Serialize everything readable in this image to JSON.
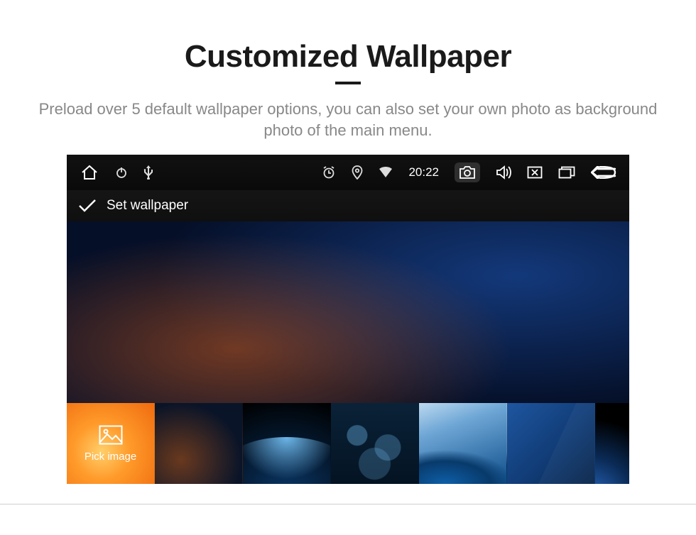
{
  "page": {
    "title": "Customized Wallpaper",
    "subtitle": "Preload over 5 default wallpaper options, you can also set your own photo as background photo of the main menu."
  },
  "status_bar": {
    "time": "20:22",
    "icons": {
      "home": "home-icon",
      "power": "power-icon",
      "usb": "usb-icon",
      "alarm": "alarm-icon",
      "location": "location-icon",
      "wifi": "wifi-icon",
      "screenshot": "camera-icon",
      "volume": "volume-icon",
      "close_app": "close-window-icon",
      "recent": "recent-apps-icon",
      "back": "back-icon"
    }
  },
  "action_row": {
    "label": "Set wallpaper"
  },
  "thumbnails": {
    "pick_label": "Pick image"
  }
}
